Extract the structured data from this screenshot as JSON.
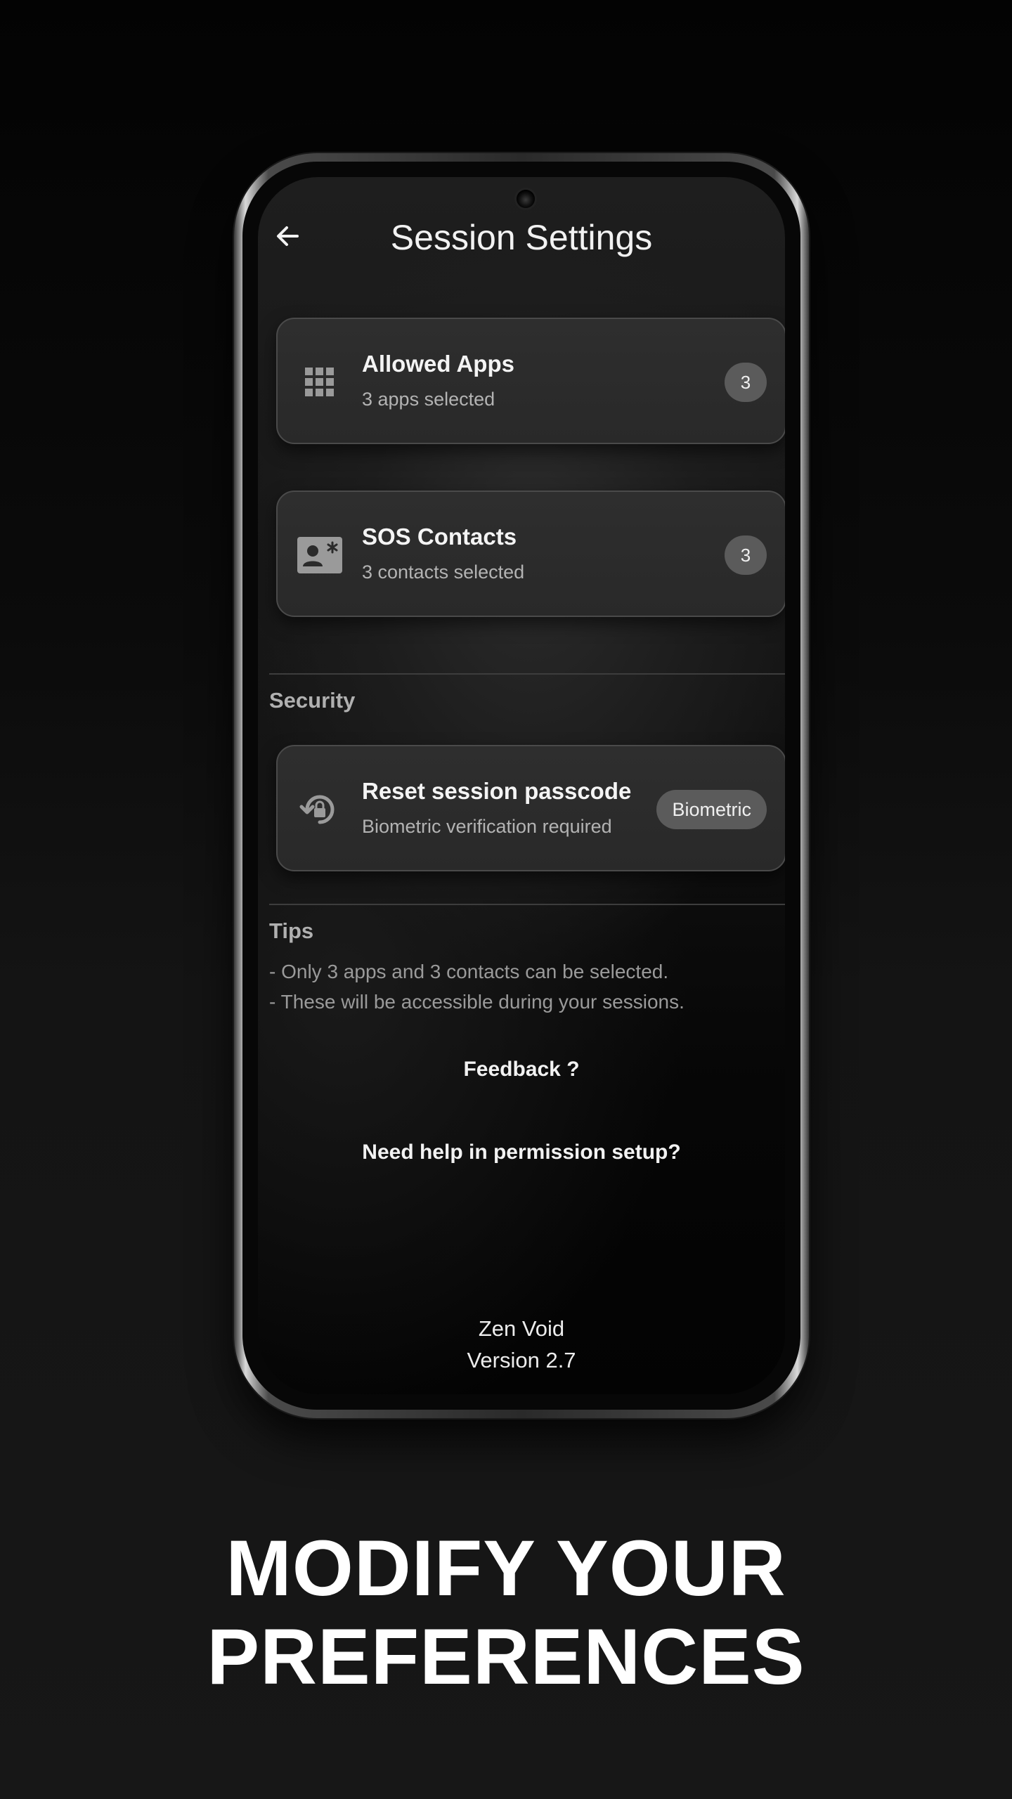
{
  "header": {
    "title": "Session Settings",
    "back_icon": "arrow-left-icon"
  },
  "cards": {
    "allowed_apps": {
      "title": "Allowed Apps",
      "subtitle": "3 apps selected",
      "count": "3",
      "icon": "apps-grid-icon"
    },
    "sos_contacts": {
      "title": "SOS Contacts",
      "subtitle": "3 contacts selected",
      "count": "3",
      "icon": "contact-card-icon"
    }
  },
  "security": {
    "heading": "Security",
    "reset_card": {
      "title": "Reset session passcode",
      "subtitle": "Biometric verification required",
      "badge": "Biometric",
      "icon": "lock-reset-icon"
    }
  },
  "tips": {
    "heading": "Tips",
    "lines": [
      "- Only 3 apps and 3 contacts can be selected.",
      "- These will be accessible during your  sessions."
    ]
  },
  "links": {
    "feedback": "Feedback ?",
    "permission_help": "Need help in permission setup?"
  },
  "footer": {
    "app_name": "Zen Void",
    "version": "Version 2.7"
  },
  "caption": {
    "line1": "MODIFY YOUR",
    "line2": "PREFERENCES"
  },
  "colors": {
    "background": "#0b0b0b",
    "card": "#2b2b2b",
    "badge": "#5b5b5b",
    "text_primary": "#f2f2f2",
    "text_secondary": "#b3b3b3"
  }
}
